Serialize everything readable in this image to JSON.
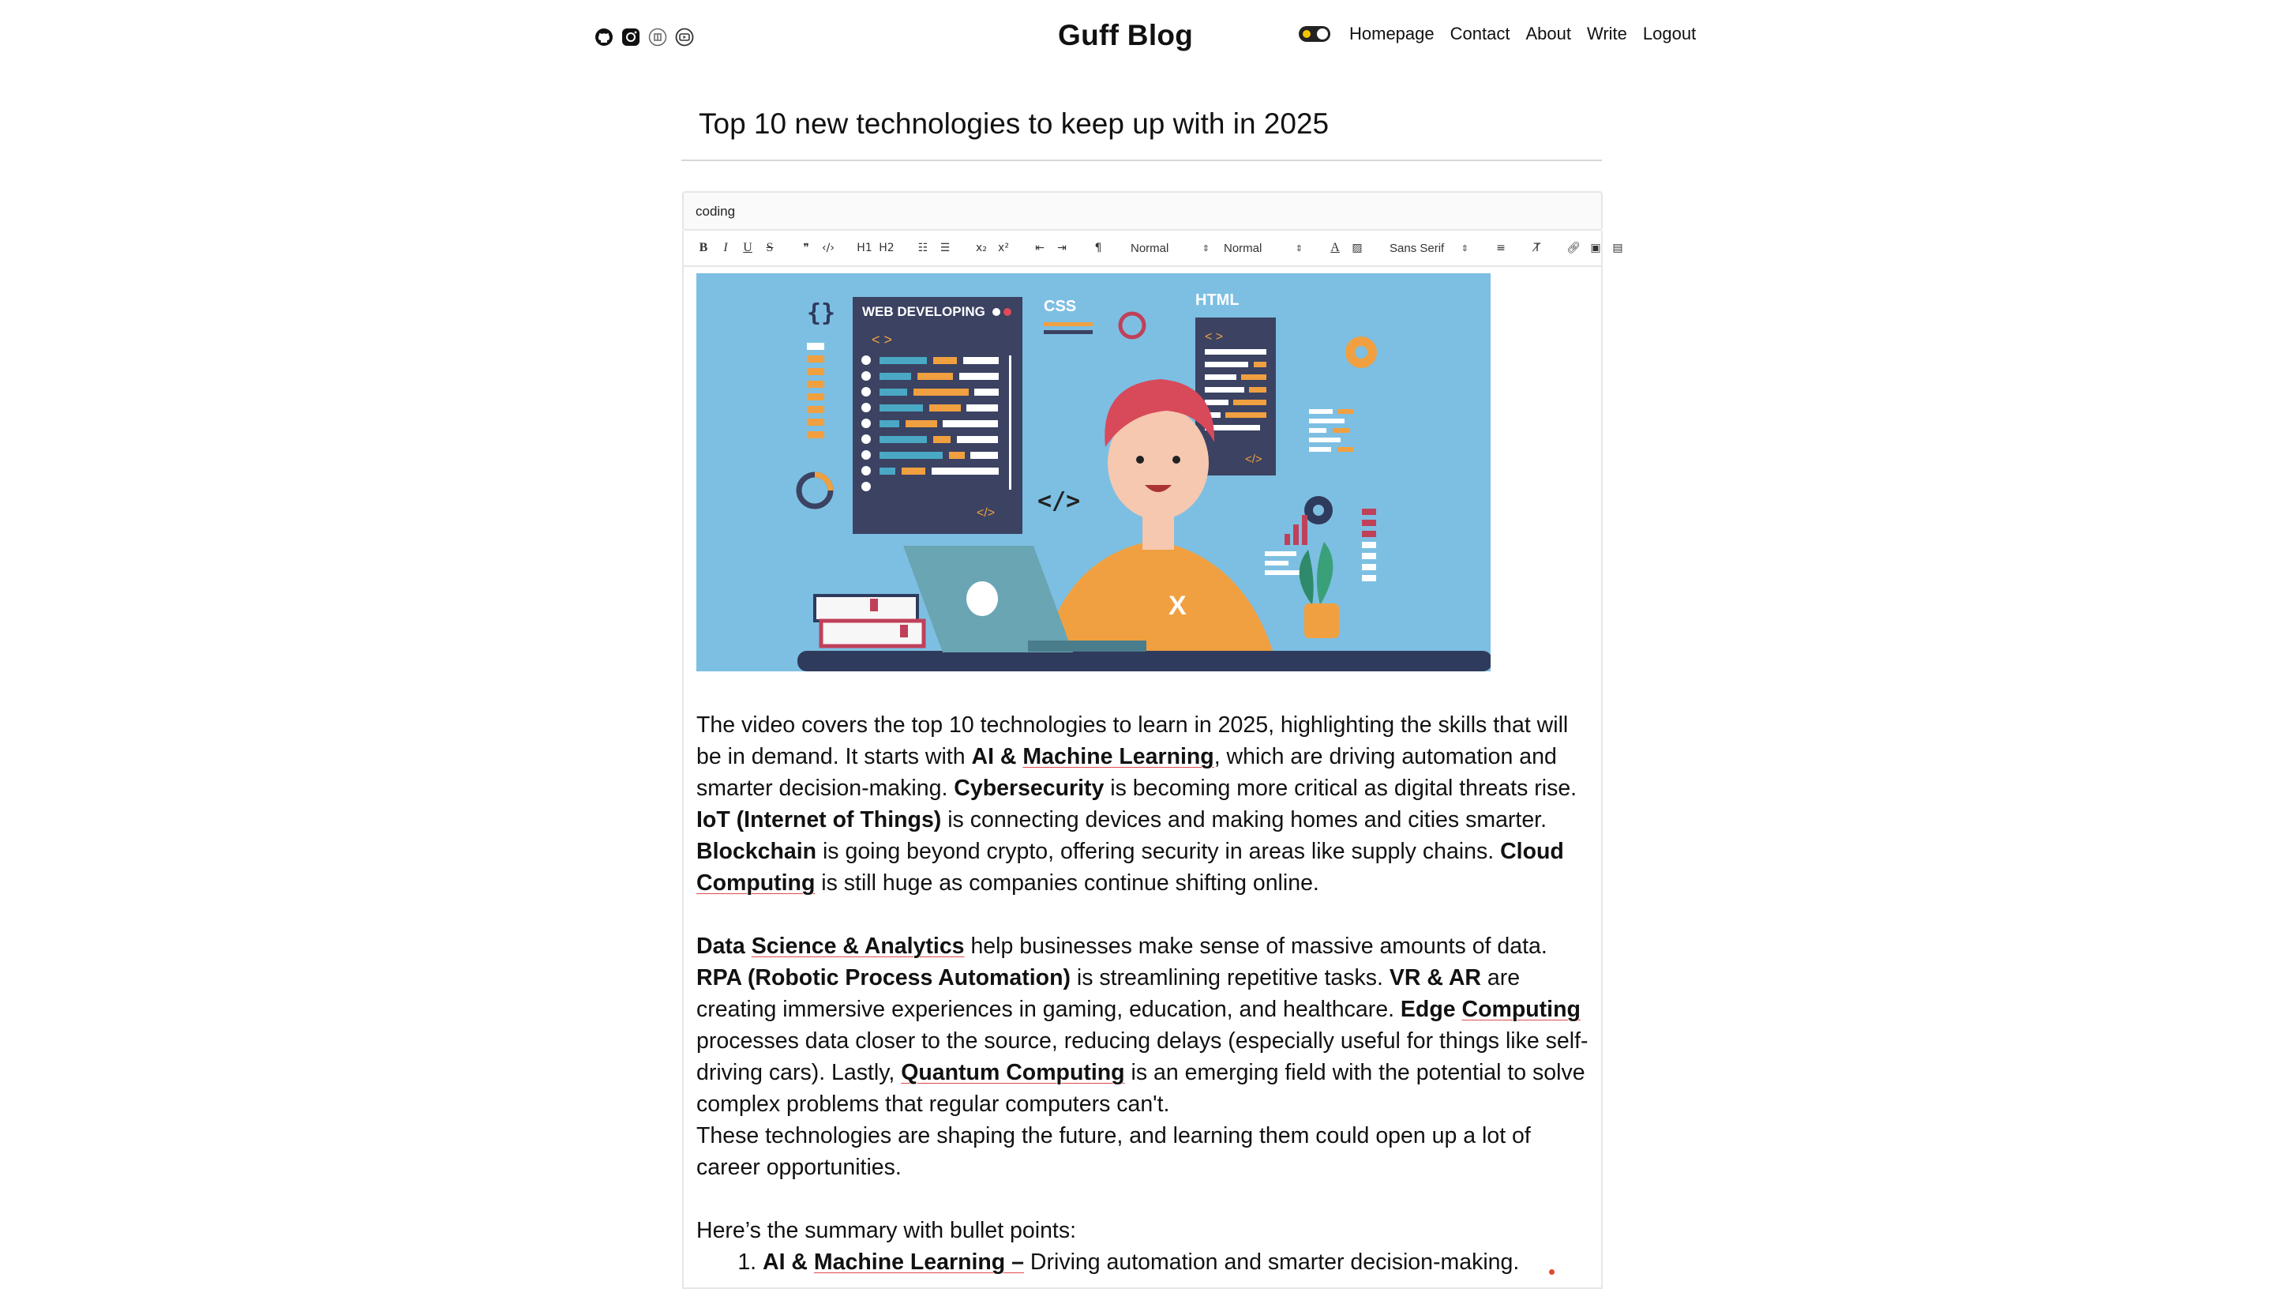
{
  "header": {
    "brand": "Guff Blog",
    "social": [
      {
        "icon": "github-icon"
      },
      {
        "icon": "instagram-icon"
      },
      {
        "icon": "medium-icon"
      },
      {
        "icon": "youtube-icon"
      }
    ],
    "theme_toggle": "dark-mode-toggle",
    "nav": [
      "Homepage",
      "Contact",
      "About",
      "Write",
      "Logout"
    ]
  },
  "post": {
    "title": "Top 10 new technologies to keep up with in 2025",
    "category": "coding"
  },
  "toolbar": {
    "bold": "B",
    "italic": "I",
    "underline": "U",
    "strike": "S",
    "h1": "H1",
    "h2": "H2",
    "sub": "x₂",
    "sup": "x²",
    "header_select": "Normal",
    "size_select": "Normal",
    "font_select": "Sans Serif"
  },
  "image": {
    "panel_label": "WEB DEVELOPING",
    "css_label": "CSS",
    "html_label": "HTML",
    "shirt_letter": "X"
  },
  "body": {
    "p1": {
      "a": "The video covers the top 10 technologies to learn in 2025, highlighting the skills that will be in demand. It starts with ",
      "b1a": "AI & ",
      "b1b": "Machine Learning",
      "c": ", which are driving automation and smarter decision-making. ",
      "b2": "Cybersecurity",
      "d": " is becoming more critical as digital threats rise. ",
      "b3": "IoT (Internet of Things)",
      "e": " is connecting devices and making homes and cities smarter. ",
      "b4": "Blockchain",
      "f": " is going beyond crypto, offering security in areas like supply chains. ",
      "b5a": "Cloud ",
      "b5b": "Computing",
      "g": " is still huge as companies continue shifting online."
    },
    "p2": {
      "b1a": "Data ",
      "b1b": "Science & Analytics",
      "a": " help businesses make sense of massive amounts of data. ",
      "b2": "RPA (Robotic Process Automation)",
      "b": " is streamlining repetitive tasks. ",
      "b3": "VR & AR",
      "c": " are creating immersive experiences in gaming, education, and healthcare. ",
      "b4a": "Edge ",
      "b4b": "Computing",
      "d": " processes data closer to the source, reducing delays (especially useful for things like self-driving cars). Lastly, ",
      "b5": "Quantum Computing",
      "e": " is an emerging field with the potential to solve complex problems that regular computers can't."
    },
    "p3": "These technologies are shaping the future, and learning them could open up a lot of career opportunities.",
    "p4": "Here’s the summary with bullet points:",
    "list": [
      {
        "a": "AI & ",
        "b": "Machine Learning",
        "c": " –",
        "text": " Driving automation and smarter decision-making."
      }
    ]
  }
}
